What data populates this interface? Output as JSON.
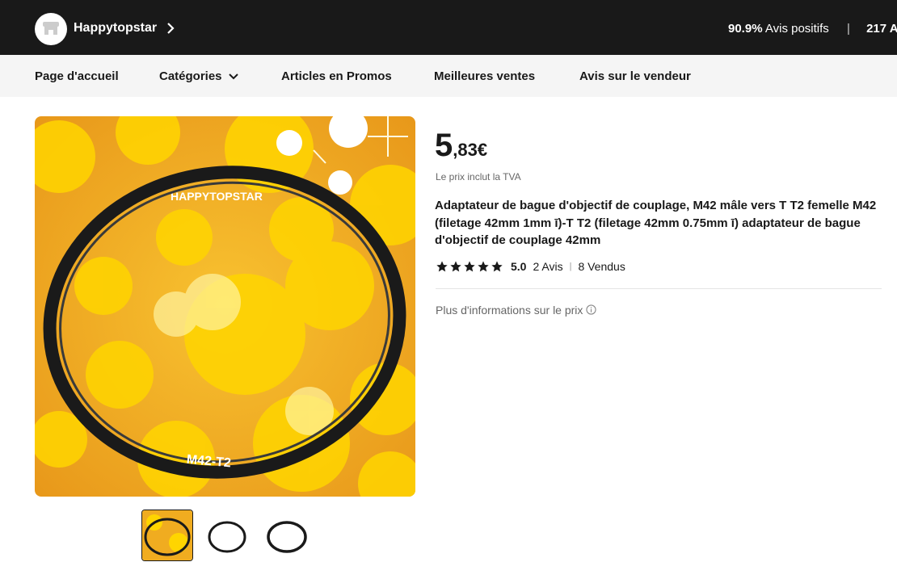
{
  "store": {
    "name": "Happytopstar",
    "positive_pct": "90.9%",
    "positive_label": "Avis positifs",
    "followers": "217 A",
    "logo_icon": "store-icon",
    "chevron_icon": "chevron-right-icon"
  },
  "nav": {
    "items": [
      {
        "label": "Page d'accueil"
      },
      {
        "label": "Catégories",
        "icon": "chevron-down-icon"
      },
      {
        "label": "Articles en Promos"
      },
      {
        "label": "Meilleures ventes"
      },
      {
        "label": "Avis sur le vendeur"
      }
    ]
  },
  "product": {
    "image_watermark": "HAPPYTOPSTAR",
    "ring_label": "M42-T2",
    "price_int": "5",
    "price_dec": ",83€",
    "vat_note": "Le prix inclut la TVA",
    "title": "Adaptateur de bague d'objectif de couplage, M42 mâle vers T T2 femelle M42 (filetage 42mm 1mm ī)-T T2 (filetage 42mm 0.75mm ī) adaptateur de bague d'objectif de couplage 42mm",
    "rating": "5.0",
    "rating_stars": 5,
    "reviews": "2 Avis",
    "sold": "8 Vendus",
    "more_price_info": "Plus d'informations sur le prix",
    "thumbnails": [
      {
        "name": "thumbnail-1",
        "active": true
      },
      {
        "name": "thumbnail-2",
        "active": false
      },
      {
        "name": "thumbnail-3",
        "active": false
      }
    ]
  },
  "colors": {
    "header_bg": "#191919",
    "nav_bg": "#f5f5f5",
    "image_bg": "#f0a81c",
    "accent_yellow": "#ffd400"
  }
}
